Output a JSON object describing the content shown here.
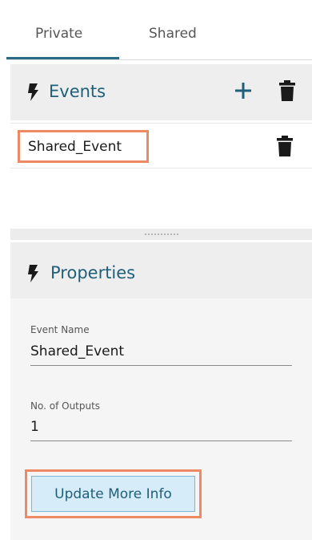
{
  "tabs": [
    {
      "label": "Private",
      "active": true
    },
    {
      "label": "Shared",
      "active": false
    }
  ],
  "events_panel": {
    "title": "Events",
    "icons": [
      "bolt-icon",
      "plus-icon",
      "trash-icon"
    ]
  },
  "event_list": [
    {
      "name": "Shared_Event",
      "highlighted": true
    }
  ],
  "properties_panel": {
    "title": "Properties",
    "event_name_label": "Event Name",
    "event_name_value": "Shared_Event",
    "outputs_label": "No. of Outputs",
    "outputs_value": "1",
    "update_button": "Update More Info"
  },
  "colors": {
    "accent": "#1f5f7a",
    "highlight": "#ee8a63",
    "button_bg": "#d6ecf8",
    "panel_bg": "#eeeeee"
  }
}
